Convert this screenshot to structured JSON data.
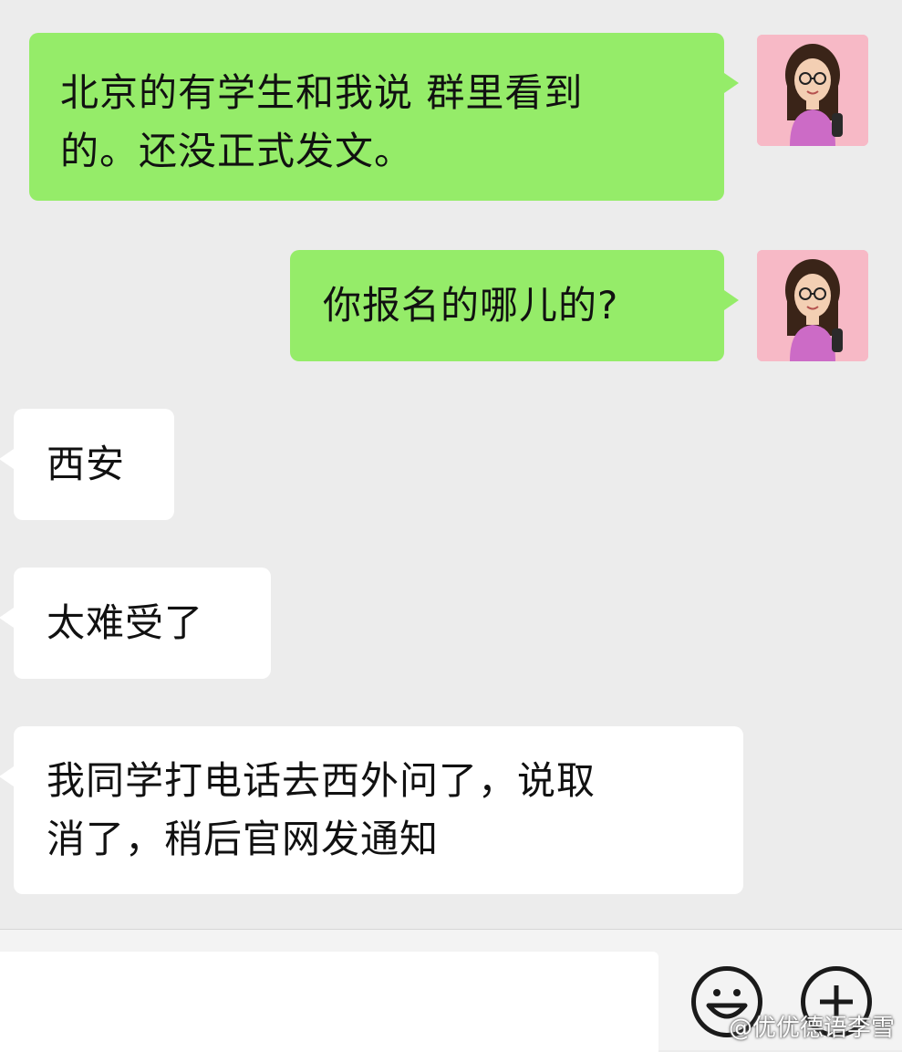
{
  "messages": [
    {
      "side": "out",
      "lines": [
        "北京的有学生和我说 群里看到",
        "的。还没正式发文。"
      ]
    },
    {
      "side": "out",
      "lines": [
        "你报名的哪儿的?"
      ]
    },
    {
      "side": "in",
      "lines": [
        "西安"
      ]
    },
    {
      "side": "in",
      "lines": [
        "太难受了"
      ]
    },
    {
      "side": "in",
      "lines": [
        "我同学打电话去西外问了，说取",
        "消了，稍后官网发通知"
      ]
    }
  ],
  "input": {
    "value": "",
    "placeholder": ""
  },
  "icons": {
    "emoji": "smiley-icon",
    "more": "plus-icon",
    "avatar": "user-avatar-glasses"
  },
  "colors": {
    "outgoing_bubble": "#95ec69",
    "incoming_bubble": "#ffffff",
    "background": "#ececec",
    "avatar_bg": "#f7b9c6"
  },
  "watermark": "@优优德语李雪"
}
